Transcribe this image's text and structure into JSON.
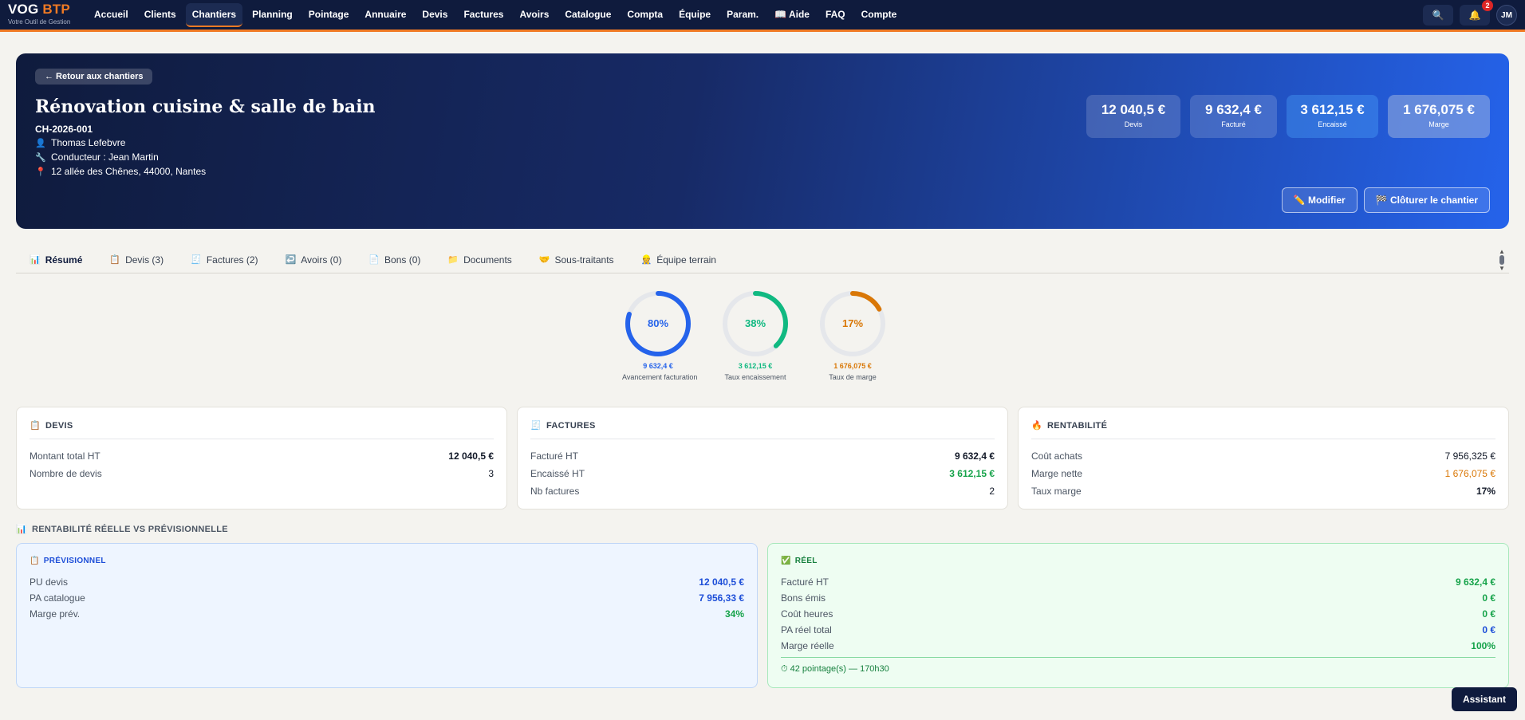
{
  "app": {
    "brand_main": "VOG",
    "brand_accent": "BTP",
    "tagline": "Votre Outil de Gestion",
    "nav": [
      "Accueil",
      "Clients",
      "Chantiers",
      "Planning",
      "Pointage",
      "Annuaire",
      "Devis",
      "Factures",
      "Avoirs",
      "Catalogue",
      "Compta",
      "Équipe",
      "Param.",
      "📖 Aide",
      "FAQ",
      "Compte"
    ],
    "active_nav": "Chantiers",
    "notif_count": "2",
    "avatar_initials": "JM"
  },
  "hero": {
    "back_label": "← Retour aux chantiers",
    "title": "Rénovation cuisine & salle de bain",
    "ref": "CH-2026-001",
    "client": "Thomas Lefebvre",
    "conducteur": "Conducteur : Jean Martin",
    "adresse": "12 allée des Chênes, 44000, Nantes",
    "kpis": [
      {
        "value": "12 040,5 €",
        "label": "Devis"
      },
      {
        "value": "9 632,4 €",
        "label": "Facturé"
      },
      {
        "value": "3 612,15 €",
        "label": "Encaissé"
      },
      {
        "value": "1 676,075 €",
        "label": "Marge"
      }
    ],
    "modify_label": "Modifier",
    "close_label": "Clôturer le chantier"
  },
  "tabs": [
    {
      "icon": "📊",
      "label": "Résumé"
    },
    {
      "icon": "📋",
      "label": "Devis (3)"
    },
    {
      "icon": "🧾",
      "label": "Factures (2)"
    },
    {
      "icon": "↩️",
      "label": "Avoirs (0)"
    },
    {
      "icon": "📄",
      "label": "Bons (0)"
    },
    {
      "icon": "📁",
      "label": "Documents"
    },
    {
      "icon": "🤝",
      "label": "Sous-traitants"
    },
    {
      "icon": "👷",
      "label": "Équipe terrain"
    }
  ],
  "gauges": [
    {
      "percent": 80,
      "percent_label": "80%",
      "amount": "9 632,4 €",
      "label": "Avancement facturation",
      "color": "#2563eb"
    },
    {
      "percent": 38,
      "percent_label": "38%",
      "amount": "3 612,15 €",
      "label": "Taux encaissement",
      "color": "#10b981"
    },
    {
      "percent": 17,
      "percent_label": "17%",
      "amount": "1 676,075 €",
      "label": "Taux de marge",
      "color": "#d97706"
    }
  ],
  "cards": {
    "devis": {
      "title": "DEVIS",
      "rows": [
        {
          "label": "Montant total HT",
          "value": "12 040,5 €"
        },
        {
          "label": "Nombre de devis",
          "value": "3"
        }
      ]
    },
    "factures": {
      "title": "FACTURES",
      "rows": [
        {
          "label": "Facturé HT",
          "value": "9 632,4 €"
        },
        {
          "label": "Encaissé HT",
          "value": "3 612,15 €"
        },
        {
          "label": "Nb factures",
          "value": "2"
        }
      ]
    },
    "rentabilite": {
      "title": "RENTABILITÉ",
      "rows": [
        {
          "label": "Coût achats",
          "value": "7 956,325 €"
        },
        {
          "label": "Marge nette",
          "value": "1 676,075 €"
        },
        {
          "label": "Taux marge",
          "value": "17%"
        }
      ]
    }
  },
  "comparison": {
    "title": "RENTABILITÉ RÉELLE VS PRÉVISIONNELLE",
    "previsionnel": {
      "title": "PRÉVISIONNEL",
      "rows": [
        {
          "label": "PU devis",
          "value": "12 040,5 €"
        },
        {
          "label": "PA catalogue",
          "value": "7 956,33 €"
        },
        {
          "label": "Marge prév.",
          "value": "34%"
        }
      ]
    },
    "reel": {
      "title": "RÉEL",
      "rows": [
        {
          "label": "Facturé HT",
          "value": "9 632,4 €"
        },
        {
          "label": "Bons émis",
          "value": "0 €"
        },
        {
          "label": "Coût heures",
          "value": "0 €"
        },
        {
          "label": "PA réel total",
          "value": "0 €"
        },
        {
          "label": "Marge réelle",
          "value": "100%"
        }
      ],
      "footer": "⏱ 42 pointage(s) — 170h30"
    }
  },
  "assistant_label": "Assistant"
}
